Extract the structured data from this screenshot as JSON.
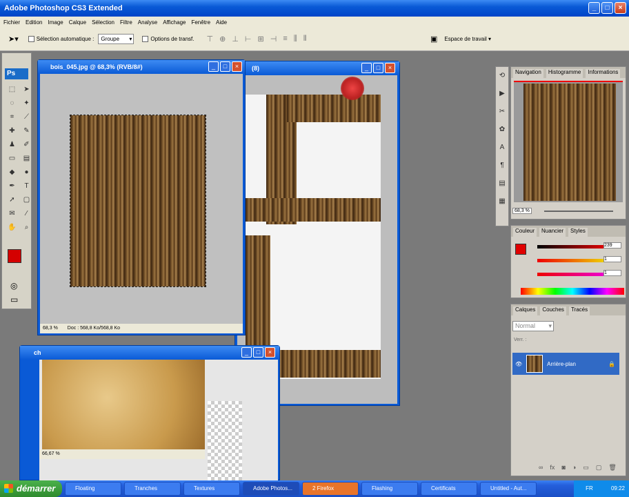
{
  "app": {
    "title": "Adobe Photoshop CS3 Extended"
  },
  "menu": [
    "Fichier",
    "Edition",
    "Image",
    "Calque",
    "Sélection",
    "Filtre",
    "Analyse",
    "Affichage",
    "Fenêtre",
    "Aide"
  ],
  "options": {
    "auto_select_label": "Sélection automatique :",
    "auto_select_value": "Groupe",
    "transform_label": "Options de transf.",
    "workspace": "Espace de travail ▾"
  },
  "doc_wood": {
    "title": "bois_045.jpg @ 68,3% (RVB/8#)",
    "zoom": "68,3 %",
    "info": "Doc : 568,8 Ko/568,8 Ko"
  },
  "doc_back": {
    "title": "(8)"
  },
  "doc_paper": {
    "title": "ch",
    "zoom": "66,67 %"
  },
  "navigator": {
    "tabs": [
      "Navigation",
      "Histogramme",
      "Informations"
    ],
    "zoom": "68,3 %"
  },
  "color": {
    "tabs": [
      "Couleur",
      "Nuancier",
      "Styles"
    ],
    "r": "239",
    "g": "1",
    "b": "1"
  },
  "layers": {
    "tabs": [
      "Calques",
      "Couches",
      "Tracés"
    ],
    "mode": "Normal",
    "lock_label": "Verr. :",
    "layer_name": "Arrière-plan"
  },
  "taskbar": {
    "start": "démarrer",
    "tasks": [
      "Floating",
      "Tranches",
      "Textures",
      "Adobe Photos...",
      "2 Firefox",
      "Flashing",
      "Certificats",
      "Untitled - Aut..."
    ],
    "lang": "FR",
    "time": "09:22"
  }
}
